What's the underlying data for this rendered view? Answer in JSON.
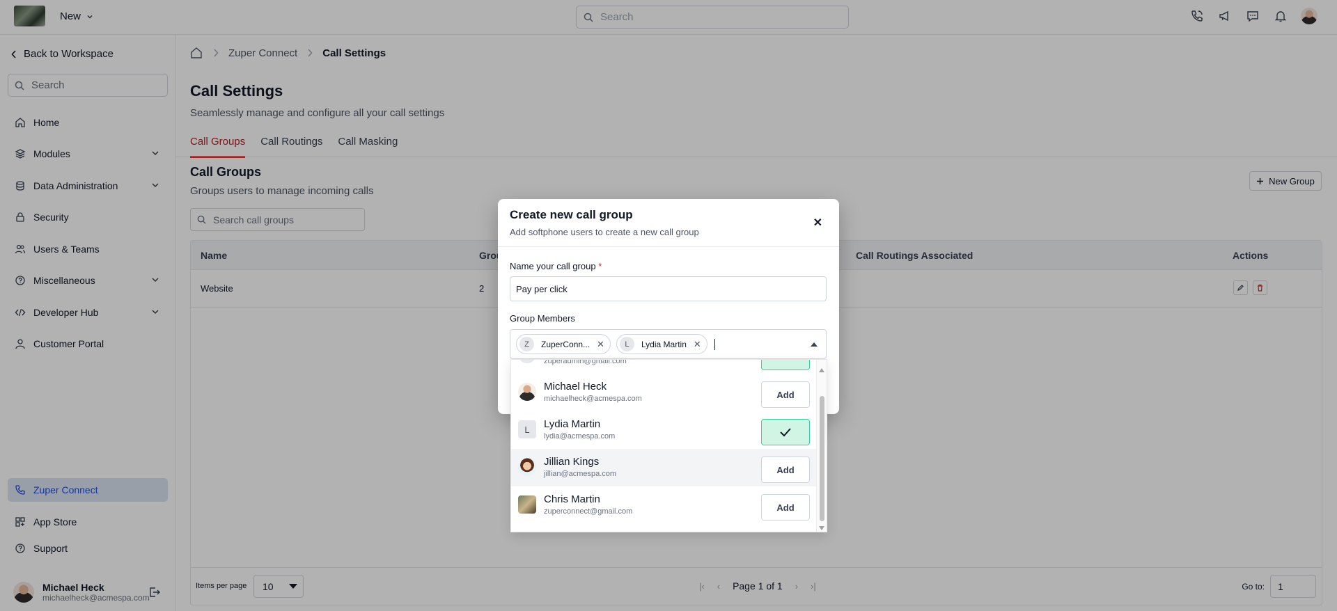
{
  "topbar": {
    "new_label": "New",
    "search_placeholder": "Search"
  },
  "sidebar": {
    "back_label": "Back to Workspace",
    "search_placeholder": "Search",
    "items": [
      {
        "label": "Home",
        "icon": "home-icon"
      },
      {
        "label": "Modules",
        "icon": "layers-icon"
      },
      {
        "label": "Data Administration",
        "icon": "database-icon"
      },
      {
        "label": "Security",
        "icon": "lock-icon"
      },
      {
        "label": "Users & Teams",
        "icon": "users-icon"
      },
      {
        "label": "Miscellaneous",
        "icon": "help-icon"
      },
      {
        "label": "Developer Hub",
        "icon": "code-icon"
      },
      {
        "label": "Customer Portal",
        "icon": "user-icon"
      }
    ],
    "bottom_items": [
      {
        "label": "Zuper Connect",
        "icon": "phone-icon"
      },
      {
        "label": "App Store",
        "icon": "grid-icon"
      },
      {
        "label": "Support",
        "icon": "help-icon"
      }
    ],
    "user": {
      "name": "Michael Heck",
      "email": "michaelheck@acmespa.com"
    }
  },
  "breadcrumb": {
    "parent": "Zuper Connect",
    "current": "Call Settings"
  },
  "page": {
    "title": "Call Settings",
    "subtitle": "Seamlessly manage and configure all your call settings",
    "tabs": [
      "Call Groups",
      "Call Routings",
      "Call Masking"
    ]
  },
  "section": {
    "title": "Call Groups",
    "subtitle": "Groups users to manage incoming calls",
    "new_group_label": "New Group",
    "search_placeholder": "Search call groups"
  },
  "table": {
    "headers": [
      "Name",
      "Grou",
      "Call Routings Associated",
      "Actions"
    ],
    "rows": [
      {
        "name": "Website",
        "count": "2"
      }
    ]
  },
  "footer": {
    "per_page_label": "Items per page",
    "per_page_value": "10",
    "page_text": "Page 1 of 1",
    "goto_label": "Go to:",
    "goto_value": "1"
  },
  "modal": {
    "title": "Create new call group",
    "subtitle": "Add softphone users to create a new call group",
    "name_label": "Name your call group",
    "required_mark": "*",
    "name_value": "Pay per click",
    "members_label": "Group Members",
    "chips": [
      {
        "initial": "Z",
        "label": "ZuperConn..."
      },
      {
        "initial": "L",
        "label": "Lydia Martin"
      }
    ]
  },
  "dropdown": {
    "partial_email": "zuperadmin@gmail.com",
    "items": [
      {
        "name": "Michael Heck",
        "email": "michaelheck@acmespa.com",
        "action": "Add",
        "added": false
      },
      {
        "name": "Lydia Martin",
        "email": "lydia@acmespa.com",
        "initial": "L",
        "added": true
      },
      {
        "name": "Jillian Kings",
        "email": "jillian@acmespa.com",
        "action": "Add",
        "added": false
      },
      {
        "name": "Chris Martin",
        "email": "zuperconnect@gmail.com",
        "action": "Add",
        "added": false
      }
    ]
  },
  "colors": {
    "accent": "#b91c1c",
    "active_nav": "#dbe4f3",
    "added": "#d1f5e4"
  }
}
